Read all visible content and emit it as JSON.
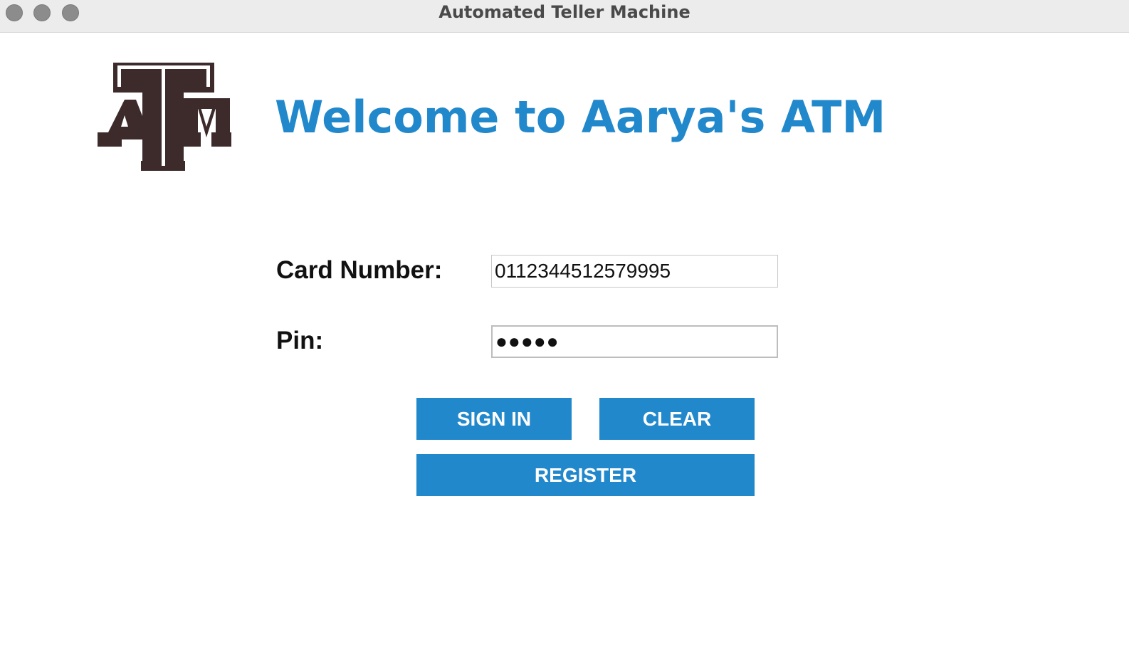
{
  "window": {
    "title": "Automated Teller Machine"
  },
  "header": {
    "logo_text": "ATM",
    "welcome": "Welcome to Aarya's ATM"
  },
  "form": {
    "card_label": "Card Number:",
    "card_value": "0112344512579995",
    "pin_label": "Pin:",
    "pin_value": "●●●●●"
  },
  "buttons": {
    "sign_in": "SIGN IN",
    "clear": "CLEAR",
    "register": "REGISTER"
  },
  "colors": {
    "accent": "#2288cc",
    "logo": "#3d2b2b",
    "titlebar": "#ececec"
  }
}
